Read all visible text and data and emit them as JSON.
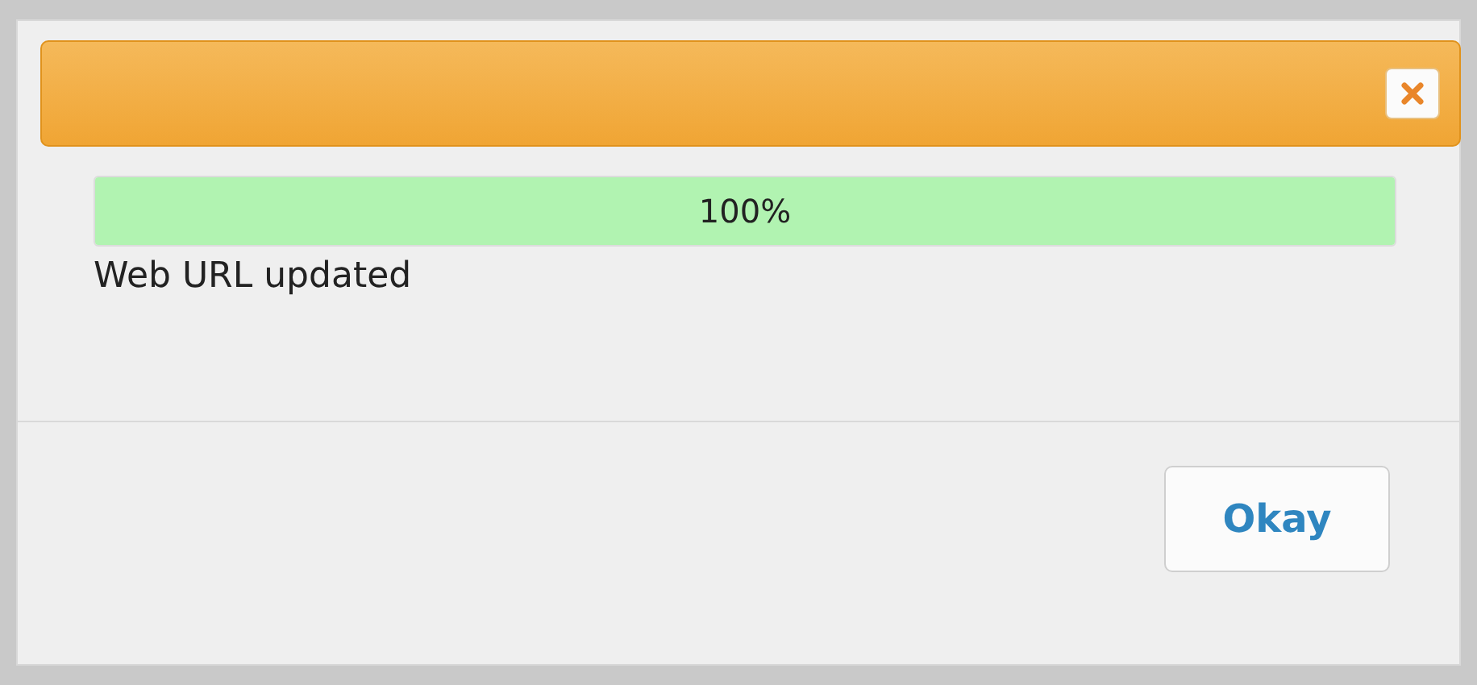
{
  "dialog": {
    "progress": {
      "level": 1.0,
      "reading": "100%"
    },
    "message": "Web URL updated",
    "buttons": [
      {
        "label": "Okay"
      }
    ]
  }
}
